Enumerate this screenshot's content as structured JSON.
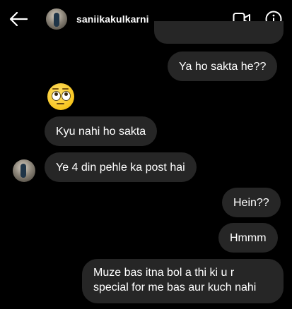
{
  "header": {
    "username": "saniikakulkarni",
    "back_icon": "arrow-left-icon",
    "video_icon": "video-camera-icon",
    "info_icon": "info-icon"
  },
  "messages": [
    {
      "side": "right",
      "text": ""
    },
    {
      "side": "right",
      "text": "Ya ho sakta he??"
    },
    {
      "side": "left",
      "type": "emoji",
      "emoji": "face-with-rolling-eyes"
    },
    {
      "side": "left",
      "text": "Kyu nahi ho sakta"
    },
    {
      "side": "left",
      "text": "Ye 4 din pehle ka post hai"
    },
    {
      "side": "right",
      "text": "Hein??"
    },
    {
      "side": "right",
      "text": "Hmmm"
    },
    {
      "side": "right",
      "lines": [
        "Muze bas itna bol a thi ki u r",
        "special for me bas aur kuch nahi"
      ]
    }
  ],
  "colors": {
    "background": "#000000",
    "bubble": "#262626",
    "text": "#ffffff"
  }
}
